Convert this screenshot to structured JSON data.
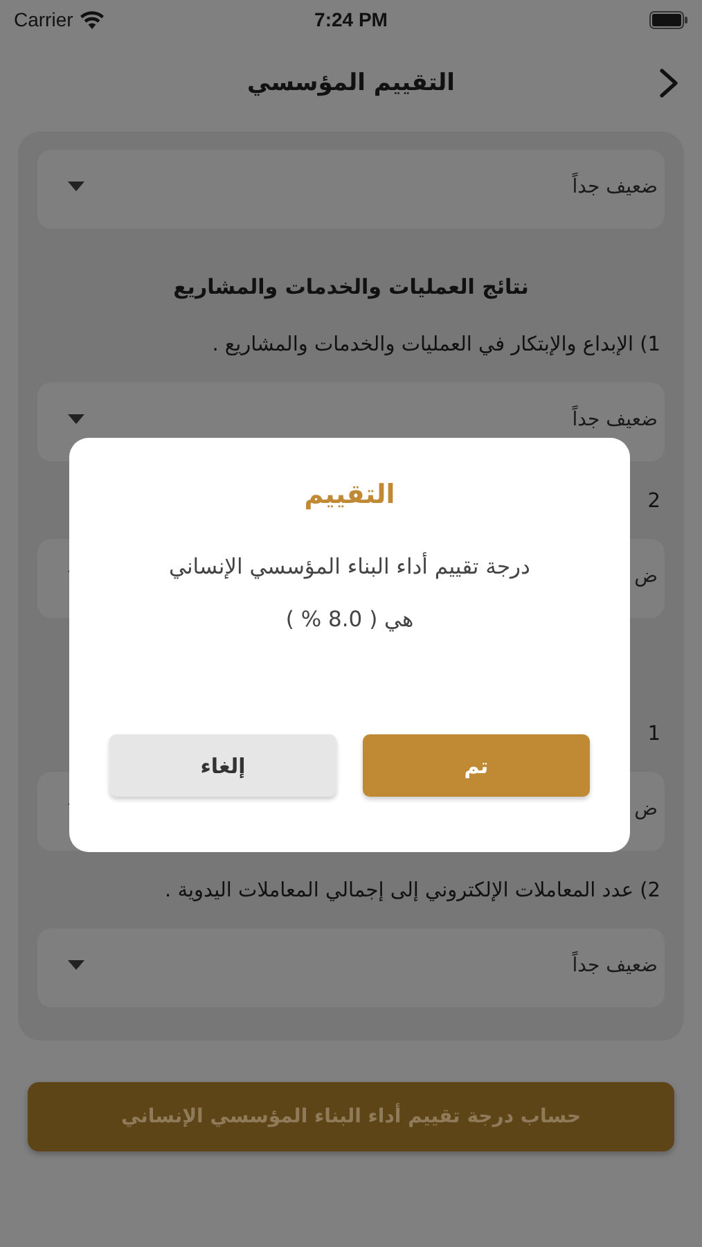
{
  "status_bar": {
    "carrier": "Carrier",
    "time": "7:24 PM"
  },
  "nav": {
    "title": "التقييم المؤسسي"
  },
  "sections": [
    {
      "items": [
        {
          "kind": "dropdown",
          "value": "ضعيف جداً"
        }
      ]
    },
    {
      "heading": "نتائج العمليات والخدمات والمشاريع",
      "items": [
        {
          "kind": "question",
          "text": "1)  الإبداع والإبتكار في العمليات والخدمات والمشاريع ."
        },
        {
          "kind": "dropdown",
          "value": "ضعيف جداً"
        },
        {
          "kind": "question",
          "text": "2"
        },
        {
          "kind": "dropdown",
          "value": "ض"
        }
      ]
    },
    {
      "items": [
        {
          "kind": "question",
          "text": "1"
        },
        {
          "kind": "dropdown",
          "value": "ض"
        },
        {
          "kind": "question",
          "text": "2)  عدد المعاملات الإلكتروني إلى إجمالي المعاملات اليدوية ."
        },
        {
          "kind": "dropdown",
          "value": "ضعيف جداً"
        }
      ]
    }
  ],
  "submit_button": "حساب  درجة تقييم أداء البناء المؤسسي الإنساني",
  "dialog": {
    "title": "التقييم",
    "message": "درجة تقييم أداء البناء المؤسسي الإنساني هي ( 8.0 % )",
    "buttons": [
      {
        "label": "تم",
        "kind": "primary"
      },
      {
        "label": "إلغاء",
        "kind": "secondary"
      }
    ]
  }
}
